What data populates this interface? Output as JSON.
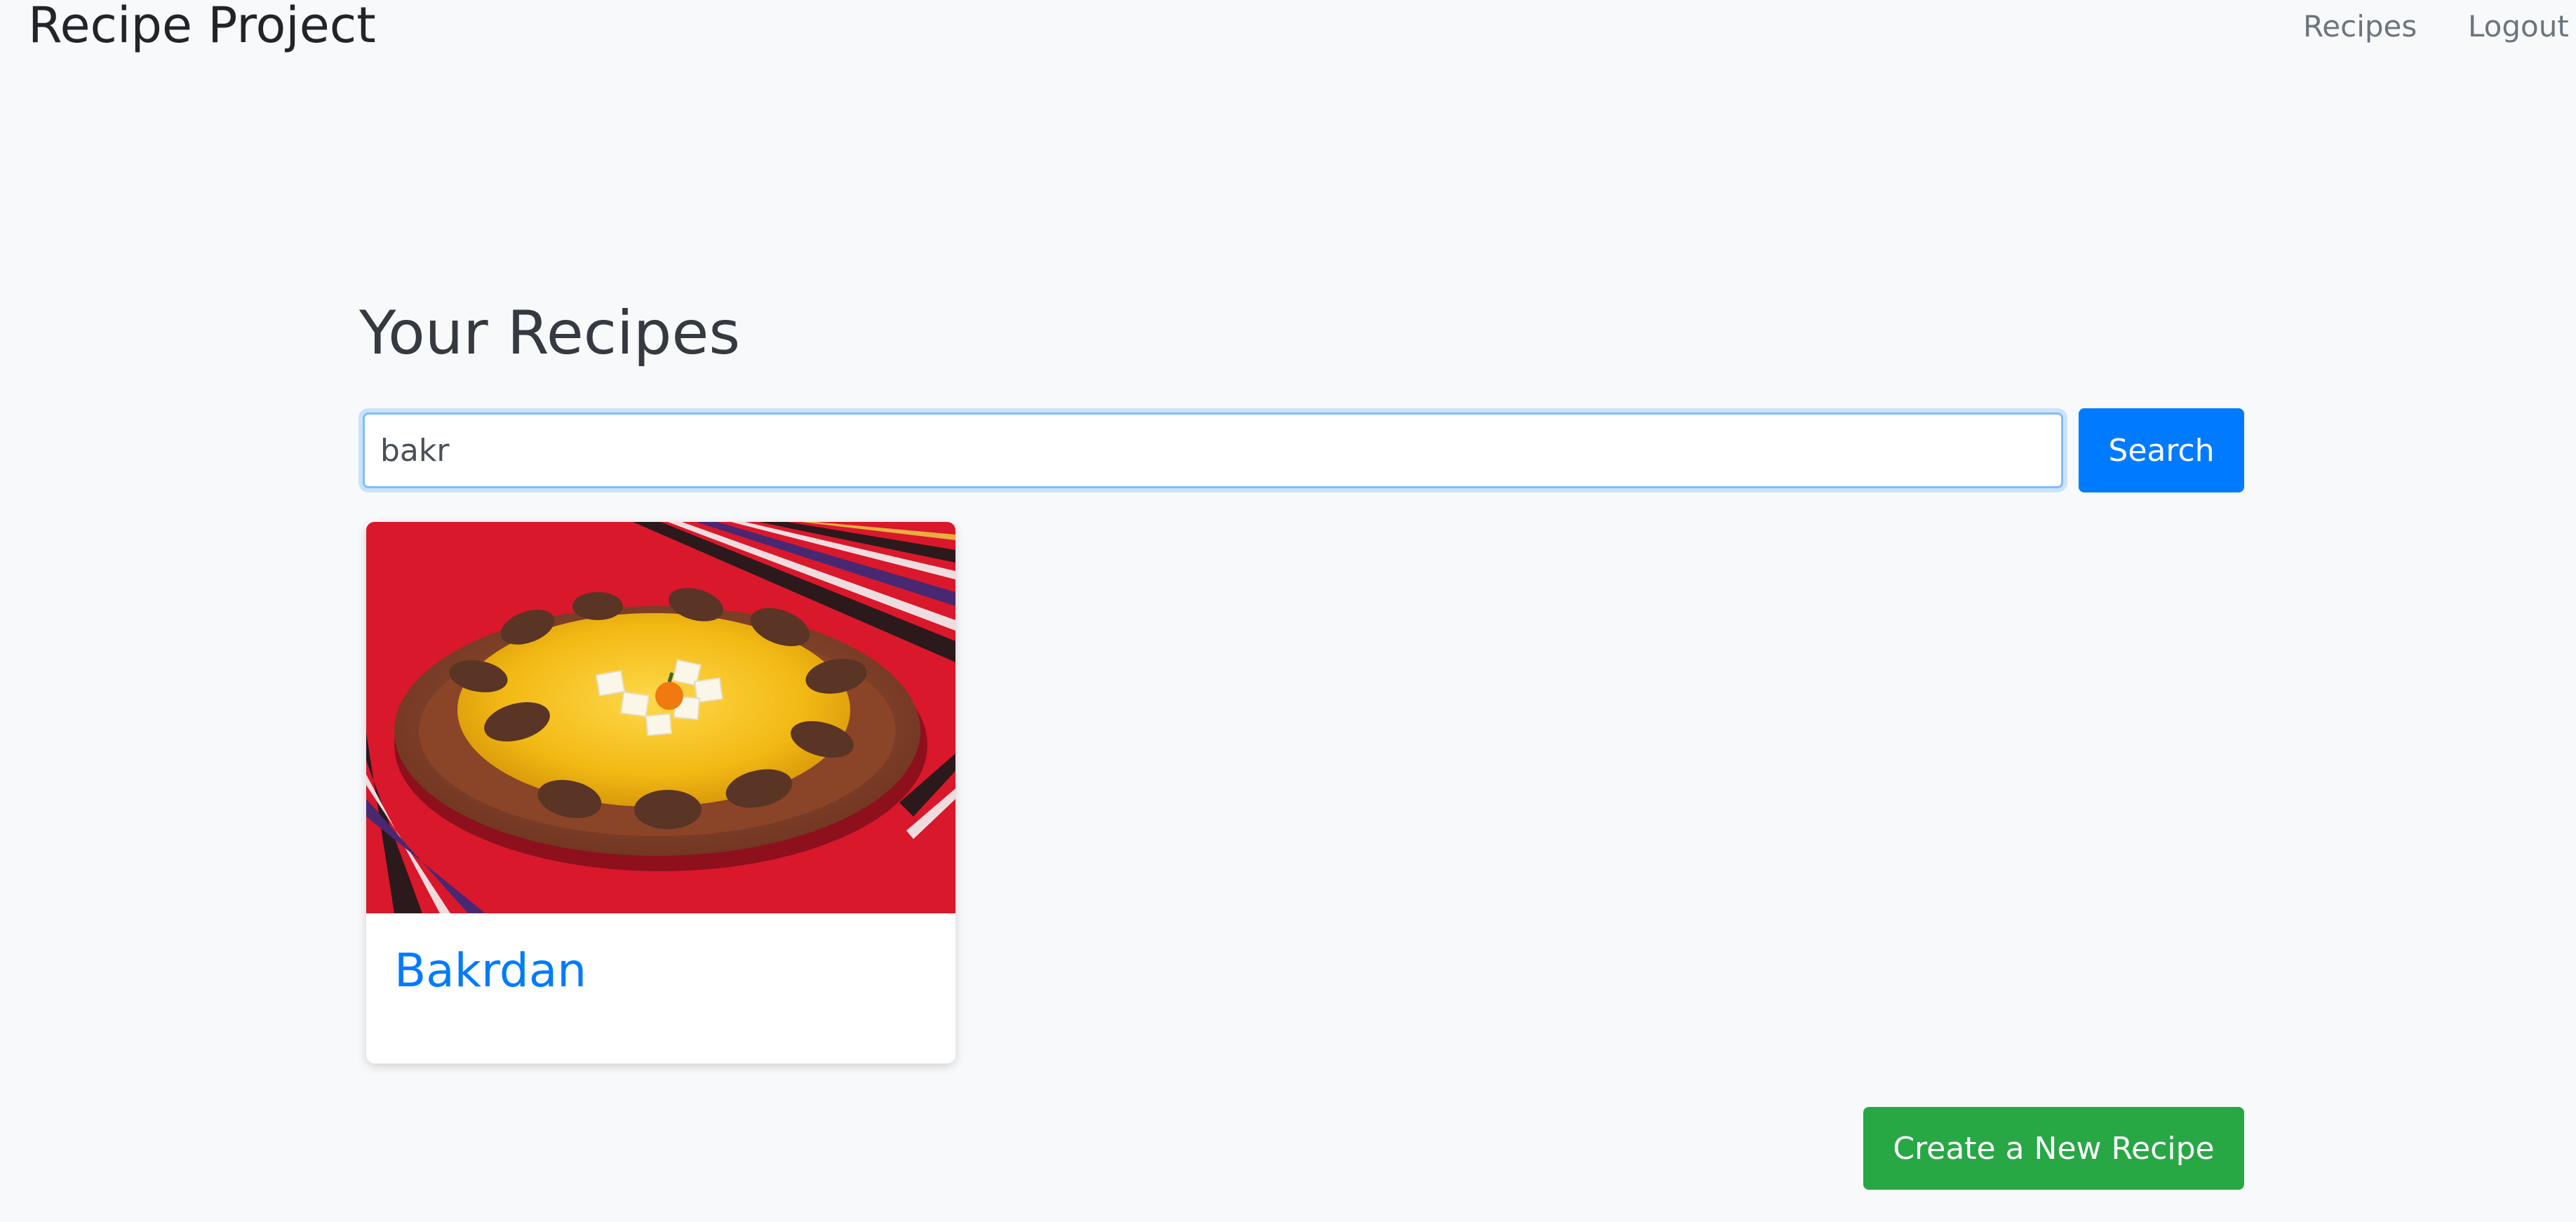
{
  "navbar": {
    "brand": "Recipe Project",
    "links": [
      {
        "label": "Recipes"
      },
      {
        "label": "Logout"
      }
    ]
  },
  "main": {
    "title": "Your Recipes",
    "search": {
      "value": "bakr",
      "button_label": "Search"
    },
    "recipes": [
      {
        "title": "Bakrdan",
        "image": "bakrdan-dish-photo"
      }
    ],
    "create_button_label": "Create a New Recipe"
  },
  "colors": {
    "primary": "#007bff",
    "success": "#28a745",
    "background": "#f8f9fa",
    "nav_link": "#6c757d"
  }
}
